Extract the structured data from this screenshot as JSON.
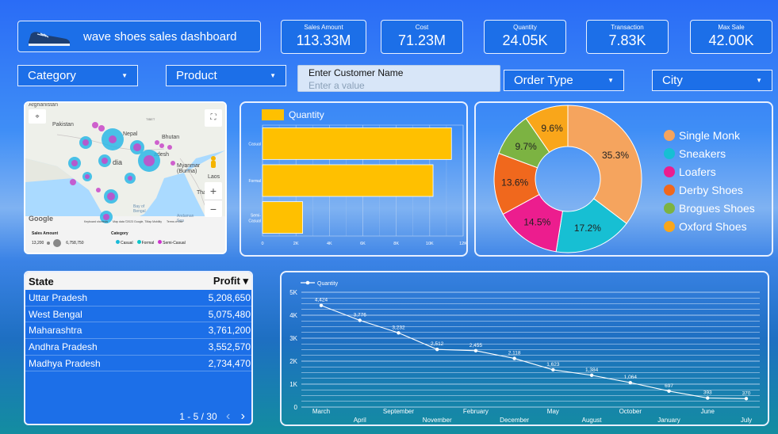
{
  "header": {
    "title": "wave shoes sales dashboard"
  },
  "kpis": [
    {
      "label": "Sales Amount",
      "value": "113.33M"
    },
    {
      "label": "Cost",
      "value": "71.23M"
    },
    {
      "label": "Quantity",
      "value": "24.05K"
    },
    {
      "label": "Transaction",
      "value": "7.83K"
    },
    {
      "label": "Max Sale",
      "value": "42.00K"
    }
  ],
  "filters": {
    "category": "Category",
    "product": "Product",
    "order_type": "Order Type",
    "city": "City",
    "customer": {
      "label": "Enter Customer Name",
      "placeholder": "Enter a value"
    }
  },
  "map": {
    "labels": {
      "afghanistan": "Afghanistan",
      "pakistan": "Pakistan",
      "nepal": "Nepal",
      "bhutan": "Bhutan",
      "india": "dia",
      "bangladesh": "adesh",
      "myanmar": "Myanmar\n(Burma)",
      "laos": "Laos",
      "bay": "Bay of Bengal",
      "thailand": "Tha",
      "tibet": "TIBET",
      "andaman": "Andaman Sea"
    },
    "attribution": [
      "Keyboard shortcuts",
      "Map data ©2023 Google, TMap Mobility",
      "Terms of Use"
    ],
    "google": "Google",
    "legend": {
      "size_title": "Sales Amount",
      "size_min": "13,200",
      "size_max": "6,758,750",
      "cat_title": "Category",
      "cats": [
        {
          "name": "Casual",
          "color": "#19b9d8"
        },
        {
          "name": "Formal",
          "color": "#0bc6c9"
        },
        {
          "name": "Semi-Casual",
          "color": "#cc33cc"
        }
      ]
    },
    "zoom_in": "+",
    "zoom_out": "−"
  },
  "chart_data": [
    {
      "type": "bar",
      "orientation": "horizontal",
      "title": "",
      "series": [
        {
          "name": "Quantity",
          "values": [
            11300,
            10200,
            2400
          ]
        }
      ],
      "categories": [
        "Casual",
        "Formal",
        "Semi-Casual"
      ],
      "xlim": [
        0,
        12000
      ],
      "xticks": [
        "0",
        "2K",
        "4K",
        "6K",
        "8K",
        "10K",
        "12K"
      ],
      "color": "#ffc000",
      "grid": true,
      "legend": "top-left"
    },
    {
      "type": "pie",
      "donut": true,
      "categories": [
        "Single Monk",
        "Sneakers",
        "Loafers",
        "Derby Shoes",
        "Brogues Shoes",
        "Oxford Shoes"
      ],
      "values": [
        35.3,
        17.2,
        14.5,
        13.6,
        9.7,
        9.6
      ],
      "labels": [
        "35.3%",
        "17.2%",
        "14.5%",
        "13.6%",
        "9.7%",
        "9.6%"
      ],
      "colors": [
        "#f5a45e",
        "#17bfd3",
        "#ec1d8e",
        "#f0681d",
        "#7cb342",
        "#f9a61a"
      ],
      "legend": "right"
    },
    {
      "type": "line",
      "series": [
        {
          "name": "Quantity",
          "values": [
            4424,
            3776,
            3232,
            2512,
            2455,
            2118,
            1623,
            1384,
            1064,
            697,
            393,
            370
          ]
        }
      ],
      "categories": [
        "March",
        "April",
        "September",
        "November",
        "February",
        "December",
        "May",
        "August",
        "October",
        "January",
        "June",
        "July"
      ],
      "data_labels": [
        "4,424",
        "3,776",
        "3,232",
        "2,512",
        "2,455",
        "2,118",
        "1,623",
        "1,384",
        "1,064",
        "697",
        "393",
        "370"
      ],
      "ylim": [
        0,
        5000
      ],
      "yticks": [
        "0",
        "1K",
        "2K",
        "3K",
        "4K",
        "5K"
      ],
      "grid": true,
      "legend": "top-left"
    }
  ],
  "table": {
    "headers": {
      "state": "State",
      "profit": "Profit ▾"
    },
    "rows": [
      {
        "state": "Uttar Pradesh",
        "profit": "5,208,650"
      },
      {
        "state": "West Bengal",
        "profit": "5,075,480"
      },
      {
        "state": "Maharashtra",
        "profit": "3,761,200"
      },
      {
        "state": "Andhra Pradesh",
        "profit": "3,552,570"
      },
      {
        "state": "Madhya Pradesh",
        "profit": "2,734,470"
      }
    ],
    "pagination": "1 - 5 / 30",
    "prev": "‹",
    "next": "›"
  }
}
